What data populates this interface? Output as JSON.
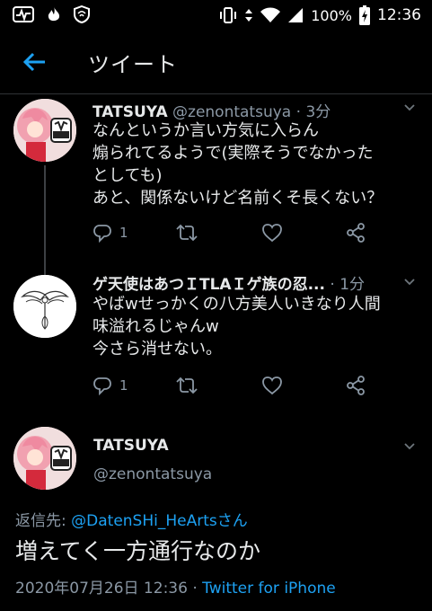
{
  "status_bar": {
    "battery": "100%",
    "time": "12:36"
  },
  "header": {
    "title": "ツイート"
  },
  "tweets": [
    {
      "name": "TATSUYA",
      "handle": "@zenontatsuya",
      "separator": "·",
      "time": "3分",
      "text": "なんというか言い方気に入らん\n煽られてるようで(実際そうでなかった\nとしても)\nあと、関係ないけど名前くそ長くない？",
      "reply_count": "1",
      "avatar_text": "TATSUYA"
    },
    {
      "name": "ゲ天使はあつＩTLAＩゲ族の忍...",
      "separator": "·",
      "time": "1分",
      "text": "やばwせっかくの八方美人いきなり人間\n味溢れるじゃんw\n今さら消せない。",
      "reply_count": "1"
    }
  ],
  "main_tweet": {
    "name": "TATSUYA",
    "handle": "@zenontatsuya",
    "reply_prefix": "返信先: ",
    "reply_mention": "@DatenSHi_HeArtsさん",
    "text": "増えてく一方通行なのか",
    "datetime": "2020年07月26日 12:36",
    "separator": " · ",
    "client": "Twitter for iPhone",
    "avatar_text": "TATSUYA"
  },
  "colors": {
    "background": "#000000",
    "accent": "#1da1f2",
    "secondary_text": "#8b98a5"
  }
}
